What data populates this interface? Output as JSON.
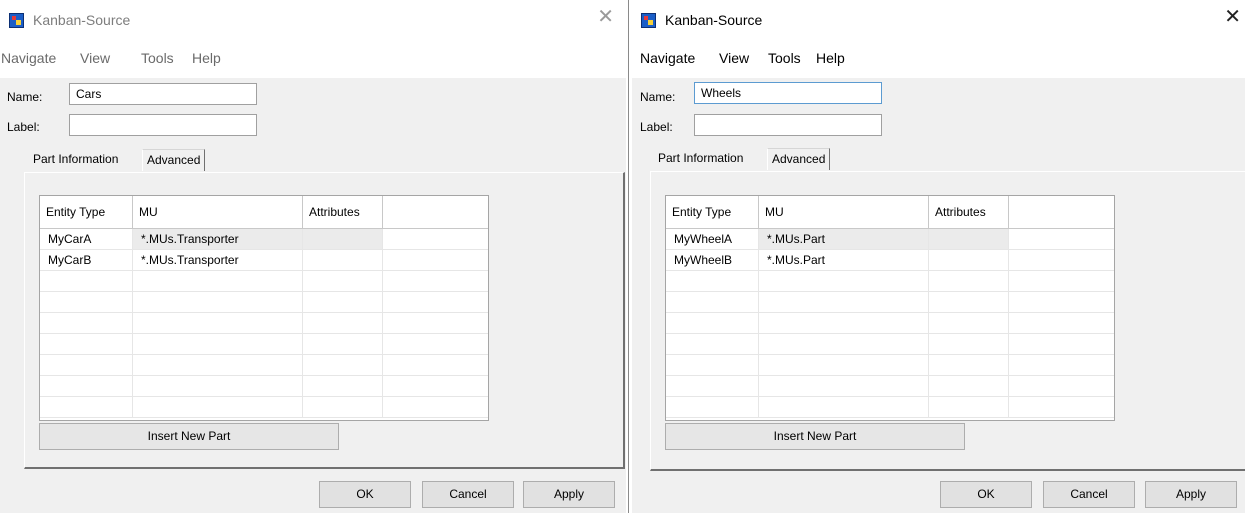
{
  "windows": [
    {
      "title": "Kanban-Source",
      "menu": [
        "Navigate",
        "View",
        "Tools",
        "Help"
      ],
      "name_label": "Name:",
      "name_value": "Cars",
      "label_label": "Label:",
      "label_value": "",
      "tabs": [
        "Part Information",
        "Advanced"
      ],
      "columns": [
        "Entity Type",
        "MU",
        "Attributes"
      ],
      "rows": [
        {
          "entity": "MyCarA",
          "mu": "*.MUs.Transporter",
          "attributes": ""
        },
        {
          "entity": "MyCarB",
          "mu": "*.MUs.Transporter",
          "attributes": ""
        }
      ],
      "insert_button": "Insert New Part",
      "buttons": {
        "ok": "OK",
        "cancel": "Cancel",
        "apply": "Apply"
      }
    },
    {
      "title": "Kanban-Source",
      "menu": [
        "Navigate",
        "View",
        "Tools",
        "Help"
      ],
      "name_label": "Name:",
      "name_value": "Wheels",
      "label_label": "Label:",
      "label_value": "",
      "tabs": [
        "Part Information",
        "Advanced"
      ],
      "columns": [
        "Entity Type",
        "MU",
        "Attributes"
      ],
      "rows": [
        {
          "entity": "MyWheelA",
          "mu": "*.MUs.Part",
          "attributes": ""
        },
        {
          "entity": "MyWheelB",
          "mu": "*.MUs.Part",
          "attributes": ""
        }
      ],
      "insert_button": "Insert New Part",
      "buttons": {
        "ok": "OK",
        "cancel": "Cancel",
        "apply": "Apply"
      }
    }
  ],
  "icons": {
    "app": "kanban-source-app-icon",
    "close": "close-icon"
  },
  "colors": {
    "focus_border": "#5c9bd1",
    "inactive_title": "#7d7d7d",
    "background": "#f0f0f0"
  }
}
